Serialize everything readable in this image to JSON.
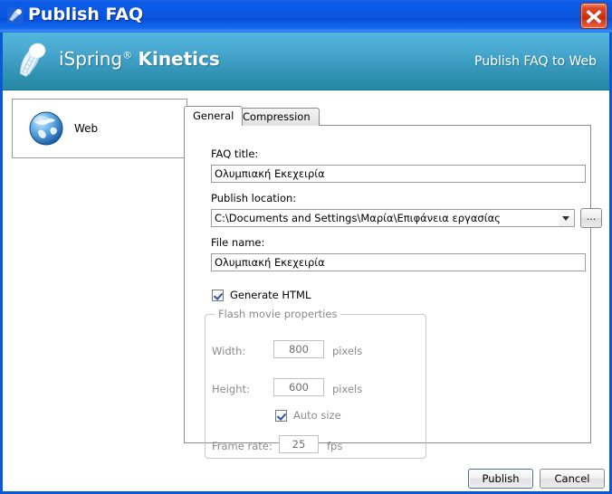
{
  "window": {
    "title": "Publish FAQ",
    "title_icon": "shuttlecock-icon",
    "close_label": "×"
  },
  "banner": {
    "brand_light": "iSpring",
    "brand_reg": "®",
    "brand_bold": "Kinetics",
    "caption": "Publish FAQ to Web",
    "logo_icon": "shuttlecock-logo",
    "color_top": "#52b6dc",
    "color_bottom": "#2489a4"
  },
  "sidebar": {
    "items": [
      {
        "label": "Web",
        "icon": "globe-icon"
      }
    ]
  },
  "tabs": [
    {
      "label": "General",
      "active": true
    },
    {
      "label": "Compression",
      "active": false
    }
  ],
  "form": {
    "faq_title": {
      "label": "FAQ title:",
      "value": "Ολυμπιακή Εκεχειρία",
      "placeholder": ""
    },
    "publish_location": {
      "label": "Publish location:",
      "value": "C:\\Documents and Settings\\Μαρία\\Επιφάνεια εργασίας",
      "placeholder": "",
      "browse_label": "..."
    },
    "file_name": {
      "label": "File name:",
      "value": "Ολυμπιακή Εκεχειρία",
      "placeholder": ""
    },
    "generate_html": {
      "label": "Generate HTML",
      "checked": true
    }
  },
  "flash_group": {
    "legend": "Flash movie properties",
    "enabled": false,
    "width": {
      "label": "Width:",
      "value": "800",
      "unit": "pixels"
    },
    "height": {
      "label": "Height:",
      "value": "600",
      "unit": "pixels"
    },
    "auto_size": {
      "label": "Auto size",
      "checked": true
    },
    "frame_rate": {
      "label": "Frame rate:",
      "value": "25",
      "unit": "fps"
    }
  },
  "footer": {
    "publish_label": "Publish",
    "cancel_label": "Cancel"
  }
}
